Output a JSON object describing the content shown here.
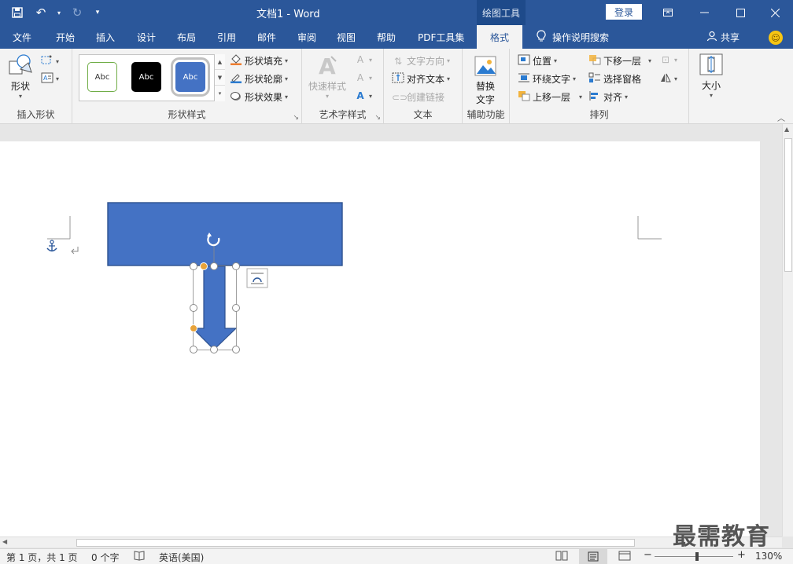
{
  "titlebar": {
    "doc_title": "文档1  -  Word",
    "context_tab": "绘图工具",
    "login": "登录"
  },
  "tabs": [
    "文件",
    "开始",
    "插入",
    "设计",
    "布局",
    "引用",
    "邮件",
    "审阅",
    "视图",
    "帮助",
    "PDF工具集",
    "格式"
  ],
  "tell_me": "操作说明搜索",
  "share": "共享",
  "ribbon": {
    "insert_shapes": {
      "shapes_label": "形状",
      "group": "插入形状"
    },
    "shape_styles": {
      "swatches": [
        "Abc",
        "Abc",
        "Abc"
      ],
      "fill": "形状填充",
      "outline": "形状轮廓",
      "effects": "形状效果",
      "group": "形状样式"
    },
    "wordart": {
      "quick_styles": "快速样式",
      "group": "艺术字样式"
    },
    "text": {
      "direction": "文字方向",
      "align": "对齐文本",
      "link": "创建链接",
      "group": "文本"
    },
    "accessibility": {
      "alt_text_1": "替换",
      "alt_text_2": "文字",
      "group": "辅助功能"
    },
    "arrange": {
      "position": "位置",
      "wrap": "环绕文字",
      "bring_forward": "上移一层",
      "send_backward": "下移一层",
      "selection_pane": "选择窗格",
      "align": "对齐",
      "group": "排列"
    },
    "size": {
      "label": "大小"
    }
  },
  "status": {
    "page": "第 1 页，共 1 页",
    "words": "0 个字",
    "language": "英语(美国)",
    "zoom": "130%"
  },
  "watermark": "最需教育",
  "colors": {
    "title_bar": "#2b579a",
    "shape_fill": "#4472c4",
    "shape_stroke": "#2f528f",
    "handle_yellow": "#e8a33a"
  }
}
